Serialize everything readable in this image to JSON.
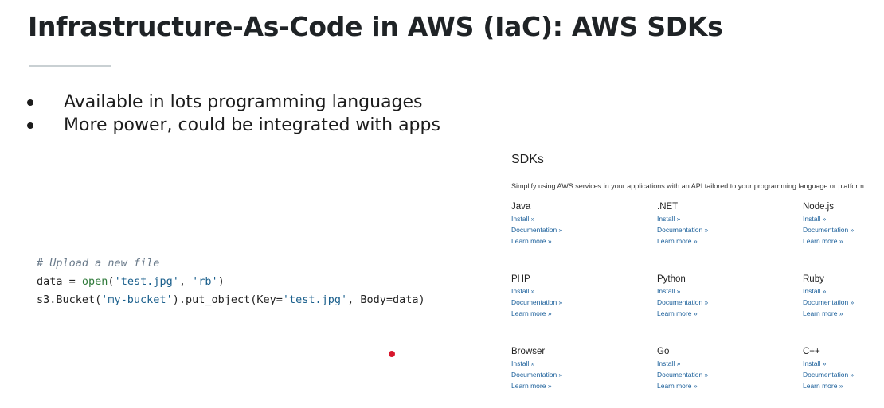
{
  "slide": {
    "title": "Infrastructure-As-Code in AWS (IaC): AWS SDKs",
    "bullets": [
      "Available in lots programming languages",
      "More power, could be integrated with apps"
    ]
  },
  "code": {
    "comment": "# Upload a new file",
    "line2_var": "data = ",
    "line2_func": "open",
    "line2_open_paren": "(",
    "line2_arg1": "'test.jpg'",
    "line2_sep": ", ",
    "line2_arg2": "'rb'",
    "line2_close": ")",
    "line3_pre": "s3.Bucket(",
    "line3_bucket": "'my-bucket'",
    "line3_mid": ").put_object(Key=",
    "line3_key": "'test.jpg'",
    "line3_end": ", Body=data)"
  },
  "sdks": {
    "heading": "SDKs",
    "description": "Simplify using AWS services in your applications with an API tailored to your programming language or platform.",
    "link_install": "Install »",
    "link_docs": "Documentation »",
    "link_learn": "Learn more »",
    "items": [
      {
        "name": "Java"
      },
      {
        "name": ".NET"
      },
      {
        "name": "Node.js"
      },
      {
        "name": "PHP"
      },
      {
        "name": "Python"
      },
      {
        "name": "Ruby"
      },
      {
        "name": "Browser"
      },
      {
        "name": "Go"
      },
      {
        "name": "C++"
      }
    ]
  },
  "colors": {
    "link": "#1a5f9a",
    "laser_pointer": "#d8162c"
  }
}
